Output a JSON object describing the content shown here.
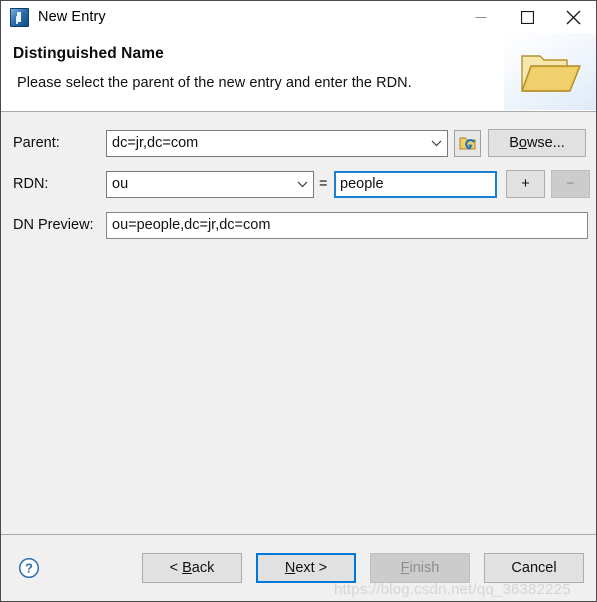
{
  "window": {
    "title": "New Entry",
    "app_icon": "apache-directory-studio-icon",
    "controls": {
      "minimize": "minimize-icon",
      "maximize": "maximize-icon",
      "close": "close-icon"
    }
  },
  "header": {
    "title": "Distinguished Name",
    "description": "Please select the parent of the new entry and enter the RDN.",
    "image": "open-folder-icon"
  },
  "form": {
    "parent": {
      "label": "Parent:",
      "value": "dc=jr,dc=com",
      "pick_icon": "folder-select-icon",
      "browse_label": "Browse...",
      "browse_mnemonic": "o"
    },
    "rdn": {
      "label": "RDN:",
      "type_value": "ou",
      "equals": "=",
      "value": "people",
      "add_label": "+",
      "remove_label": "−"
    },
    "dn_preview": {
      "label": "DN Preview:",
      "value": "ou=people,dc=jr,dc=com"
    }
  },
  "footer": {
    "help_icon": "help-question-icon",
    "buttons": {
      "back": {
        "prefix": "< ",
        "mnemonic": "B",
        "suffix": "ack"
      },
      "next": {
        "prefix": "",
        "mnemonic": "N",
        "suffix": "ext >"
      },
      "finish": {
        "prefix": "",
        "mnemonic": "F",
        "suffix": "inish"
      },
      "cancel": {
        "prefix": "",
        "mnemonic": "",
        "suffix": "Cancel"
      }
    }
  },
  "watermark": "https://blog.csdn.net/qq_36382225",
  "colors": {
    "accent": "#0078d7",
    "focus_border": "#1b7fd1",
    "body_bg": "#f0f0f0",
    "header_bg": "#ffffff",
    "folder": "#e8c354"
  }
}
